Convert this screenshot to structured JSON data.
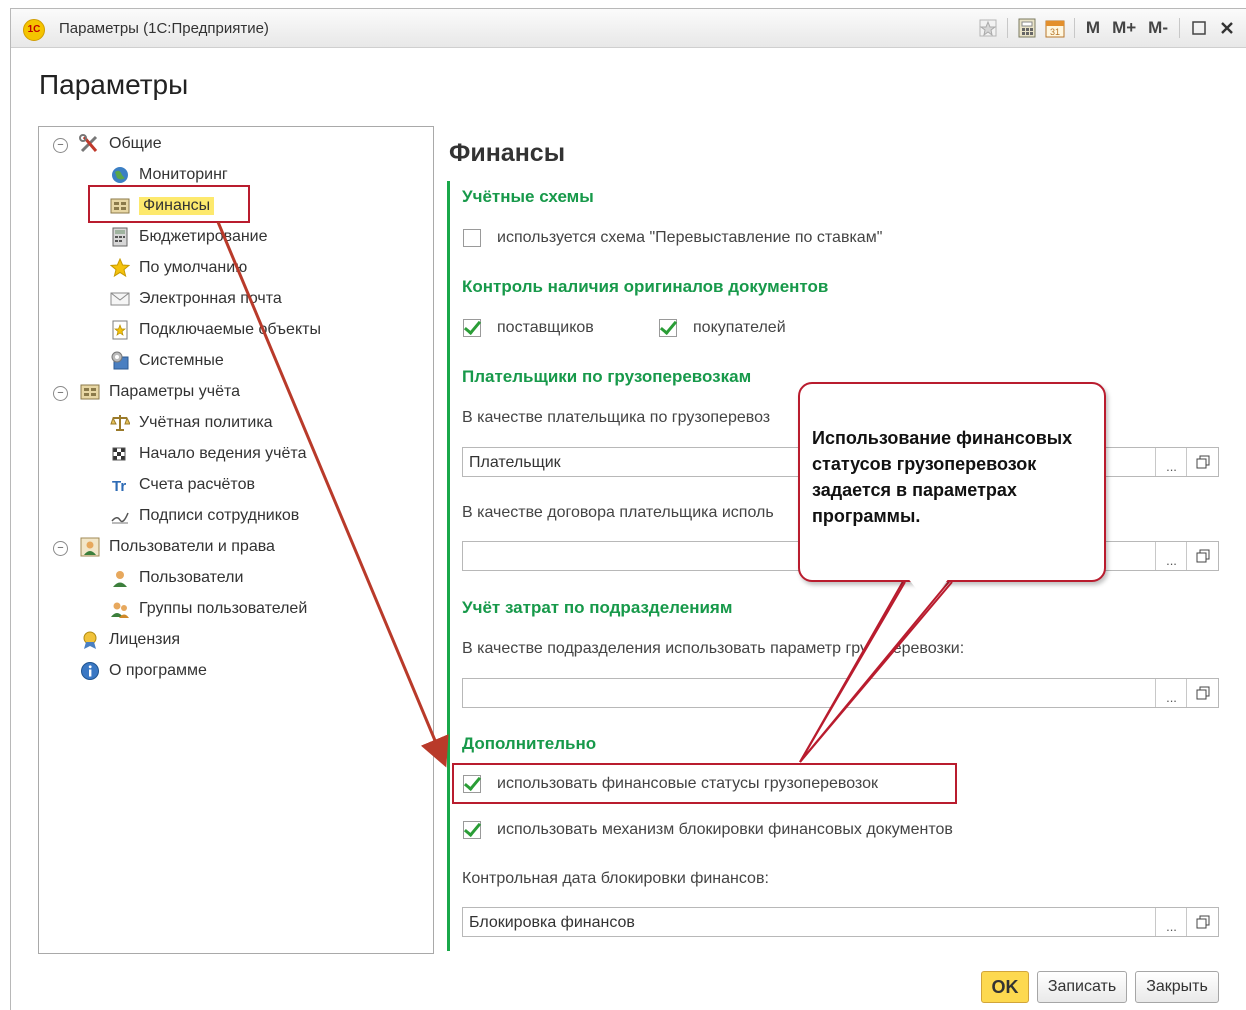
{
  "window": {
    "title": "Параметры  (1С:Предприятие)",
    "logo_text": "1С",
    "toolbar": {
      "m": "M",
      "m_plus": "M+",
      "m_minus": "M-"
    }
  },
  "page_title": "Параметры",
  "tree": {
    "items": [
      {
        "label": "Общие",
        "icon": "tools-icon"
      },
      {
        "label": "Мониторинг",
        "icon": "globe-icon"
      },
      {
        "label": "Финансы",
        "icon": "finance-icon",
        "selected": true
      },
      {
        "label": "Бюджетирование",
        "icon": "calculator-icon"
      },
      {
        "label": "По умолчанию",
        "icon": "star-icon"
      },
      {
        "label": "Электронная почта",
        "icon": "mail-icon"
      },
      {
        "label": "Подключаемые объекты",
        "icon": "plugin-icon"
      },
      {
        "label": "Системные",
        "icon": "system-icon"
      },
      {
        "label": "Параметры учёта",
        "icon": "accounting-icon"
      },
      {
        "label": "Учётная политика",
        "icon": "scales-icon"
      },
      {
        "label": "Начало ведения учёта",
        "icon": "flag-icon"
      },
      {
        "label": "Счета расчётов",
        "icon": "accounts-icon"
      },
      {
        "label": "Подписи сотрудников",
        "icon": "signature-icon"
      },
      {
        "label": "Пользователи и права",
        "icon": "users-rights-icon"
      },
      {
        "label": "Пользователи",
        "icon": "user-icon"
      },
      {
        "label": "Группы пользователей",
        "icon": "user-group-icon"
      },
      {
        "label": "Лицензия",
        "icon": "license-icon"
      },
      {
        "label": "О программе",
        "icon": "info-icon"
      }
    ]
  },
  "main": {
    "title": "Финансы",
    "sections": {
      "accounting_schemes": {
        "title": "Учётные схемы",
        "checkbox_label": "используется схема \"Перевыставление по ставкам\"",
        "checked": false
      },
      "originals_control": {
        "title": "Контроль наличия оригиналов документов",
        "suppliers_label": "поставщиков",
        "suppliers_checked": true,
        "buyers_label": "покупателей",
        "buyers_checked": true
      },
      "payers": {
        "title": "Плательщики по грузоперевозкам",
        "payer_label": "В качестве плательщика по грузоперевоз",
        "payer_value": "Плательщик",
        "contract_label": "В качестве договора плательщика исполь",
        "contract_value": ""
      },
      "costs": {
        "title": "Учёт затрат по подразделениям",
        "division_label": "В качестве подразделения использовать параметр грузоперевозки:",
        "division_value": ""
      },
      "additional": {
        "title": "Дополнительно",
        "fin_status_label": "использовать финансовые статусы грузоперевозок",
        "fin_status_checked": true,
        "lock_label": "использовать механизм блокировки финансовых документов",
        "lock_checked": true,
        "lock_date_label": "Контрольная дата блокировки финансов:",
        "lock_date_value": "Блокировка финансов"
      }
    },
    "field_button_label": "..."
  },
  "callout": {
    "text": "Использование финансовых статусов грузоперевозок задается в параметрах программы."
  },
  "buttons": {
    "ok": "OK",
    "save": "Записать",
    "close": "Закрыть"
  },
  "colors": {
    "section_green": "#17994a",
    "highlight_red": "#b91c2e",
    "selected_yellow": "#fde96d",
    "ok_button": "#fdd94f"
  }
}
